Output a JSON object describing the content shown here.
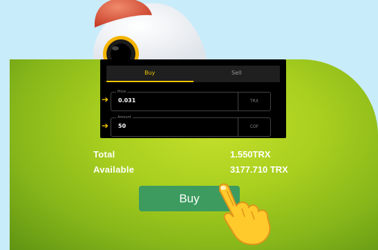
{
  "trade": {
    "tabs": [
      {
        "label": "Buy",
        "active": true
      },
      {
        "label": "Sell",
        "active": false
      }
    ],
    "price": {
      "legend": "Price",
      "value": "0.031",
      "unit": "TRX"
    },
    "amount": {
      "legend": "Amount",
      "value": "50",
      "unit": "COF"
    }
  },
  "summary": {
    "total_label": "Total",
    "total_value": "1.550TRX",
    "available_label": "Available",
    "available_value": "3177.710 TRX"
  },
  "buy_button": {
    "label": "Buy"
  },
  "icons": [
    "rocket-icon",
    "arrow-right-icon",
    "pointing-hand-icon"
  ],
  "colors": {
    "accent": "#f2c500",
    "button": "#3d9b5f",
    "panel": "#a9cf1f",
    "background": "#c9ecfb"
  }
}
